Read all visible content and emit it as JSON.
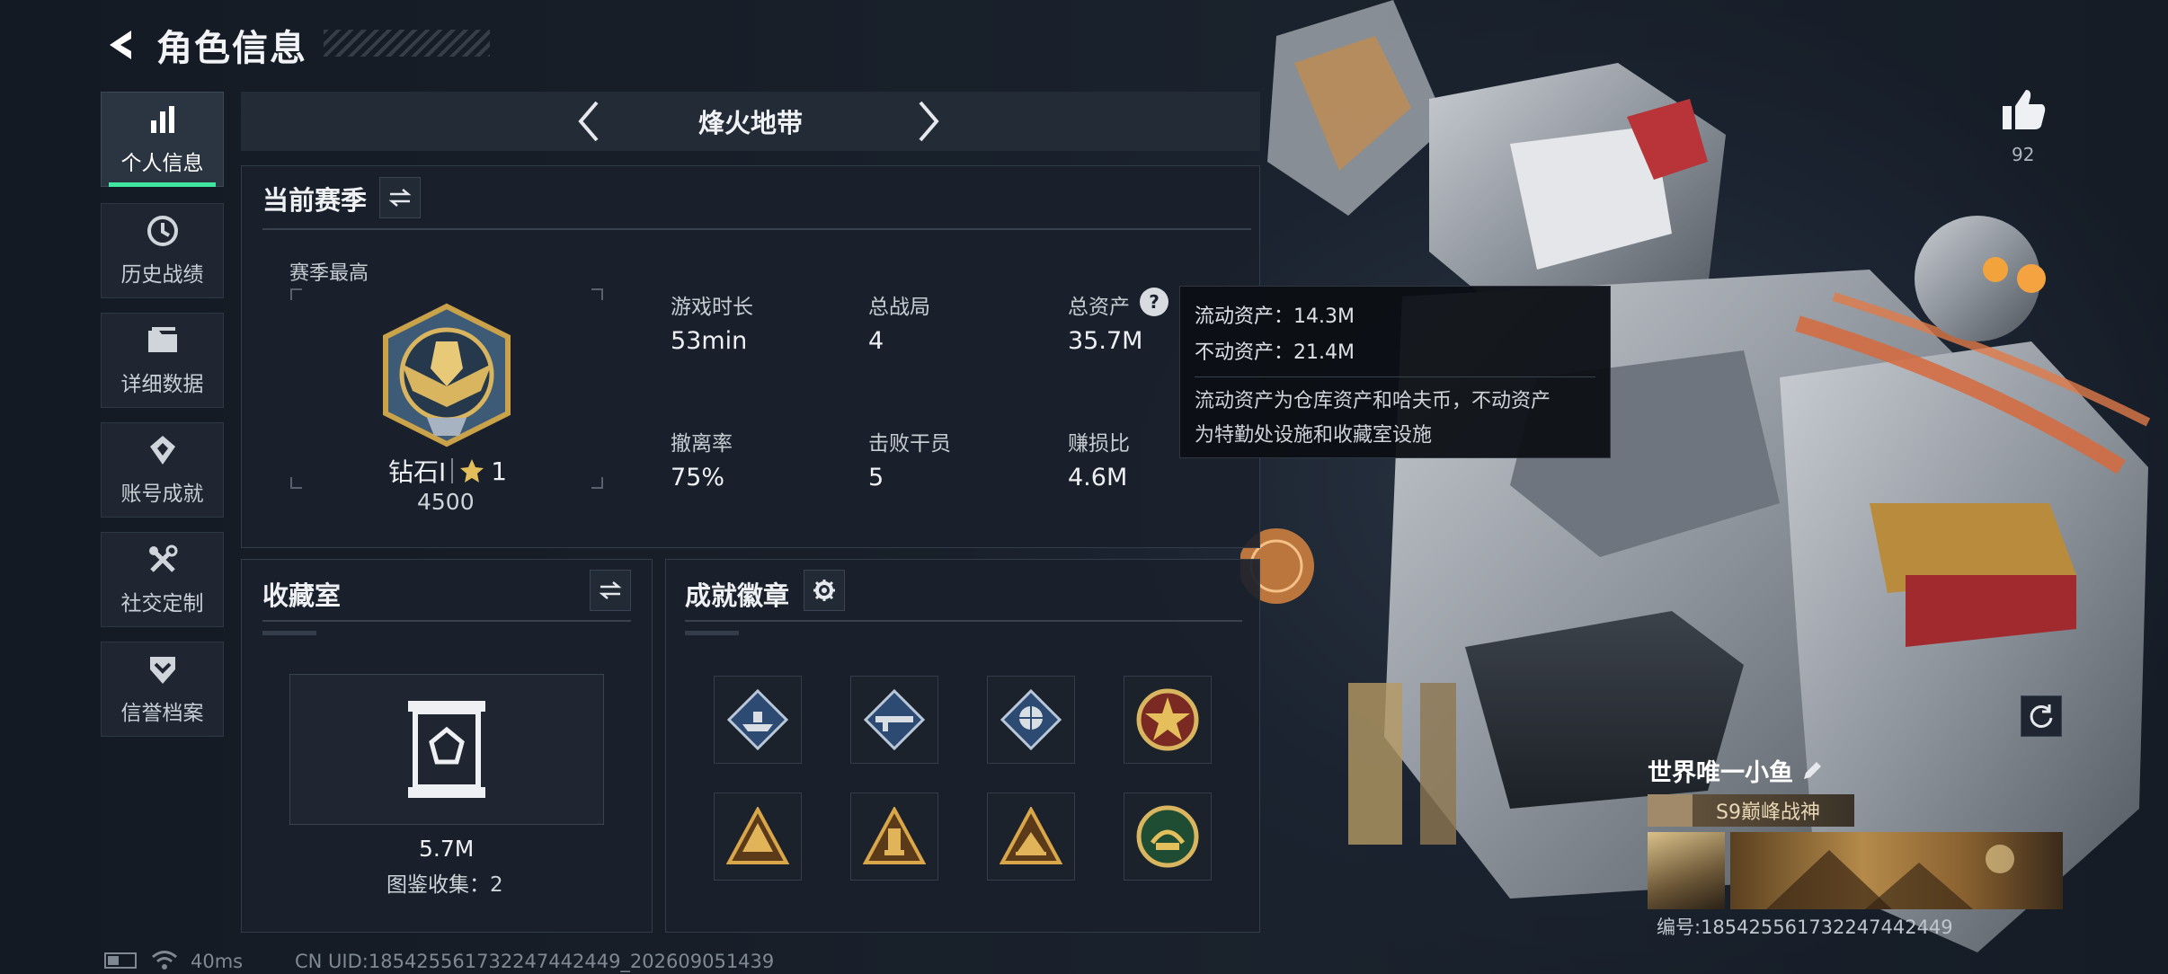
{
  "header": {
    "title": "角色信息"
  },
  "sidebar": {
    "items": [
      {
        "label": "个人信息",
        "icon": "bar-chart-icon",
        "active": true
      },
      {
        "label": "历史战绩",
        "icon": "clock-icon"
      },
      {
        "label": "详细数据",
        "icon": "folder-icon"
      },
      {
        "label": "账号成就",
        "icon": "medal-icon"
      },
      {
        "label": "社交定制",
        "icon": "tools-icon"
      },
      {
        "label": "信誉档案",
        "icon": "shield-chevron-icon"
      }
    ]
  },
  "mode_selector": {
    "title": "烽火地带"
  },
  "season": {
    "title": "当前赛季",
    "best_label": "赛季最高",
    "rank_name": "钻石I",
    "rank_stars": "1",
    "rank_points": "4500",
    "stats": [
      {
        "label": "游戏时长",
        "value": "53min"
      },
      {
        "label": "总战局",
        "value": "4"
      },
      {
        "label": "总资产",
        "value": "35.7M"
      },
      {
        "label": "撤离率",
        "value": "75%"
      },
      {
        "label": "击败干员",
        "value": "5"
      },
      {
        "label": "赚损比",
        "value": "4.6M"
      }
    ],
    "help_glyph": "?"
  },
  "tooltip": {
    "line1": "流动资产：14.3M",
    "line2": "不动资产：21.4M",
    "desc1": "流动资产为仓库资产和哈夫币，不动资产",
    "desc2": "为特勤处设施和收藏室设施"
  },
  "collection": {
    "title": "收藏室",
    "value": "5.7M",
    "count_text": "图鉴收集：2"
  },
  "badges": {
    "title": "成就徽章",
    "items": [
      {
        "icon": "badge-boat-icon",
        "color": "#3b6aa8"
      },
      {
        "icon": "badge-rifle-icon",
        "color": "#3b6aa8"
      },
      {
        "icon": "badge-globe-icon",
        "color": "#3b6aa8"
      },
      {
        "icon": "badge-star-icon",
        "color": "#b8902f"
      },
      {
        "icon": "badge-pyramid-icon",
        "color": "#b8902f"
      },
      {
        "icon": "badge-tower-icon",
        "color": "#b8902f"
      },
      {
        "icon": "badge-temple-icon",
        "color": "#b8902f"
      },
      {
        "icon": "badge-wreath-icon",
        "color": "#2f7a4a"
      }
    ]
  },
  "likes": {
    "count": "92"
  },
  "player_card": {
    "name": "世界唯一小鱼",
    "title_tag": "S9巅峰战神",
    "id_text": "编号:185425561732247442449"
  },
  "status_bar": {
    "ping": "40ms",
    "uid": "CN UID:185425561732247442449_202609051439"
  },
  "colors": {
    "accent": "#3ee6a0",
    "gold": "#c9a24a"
  }
}
